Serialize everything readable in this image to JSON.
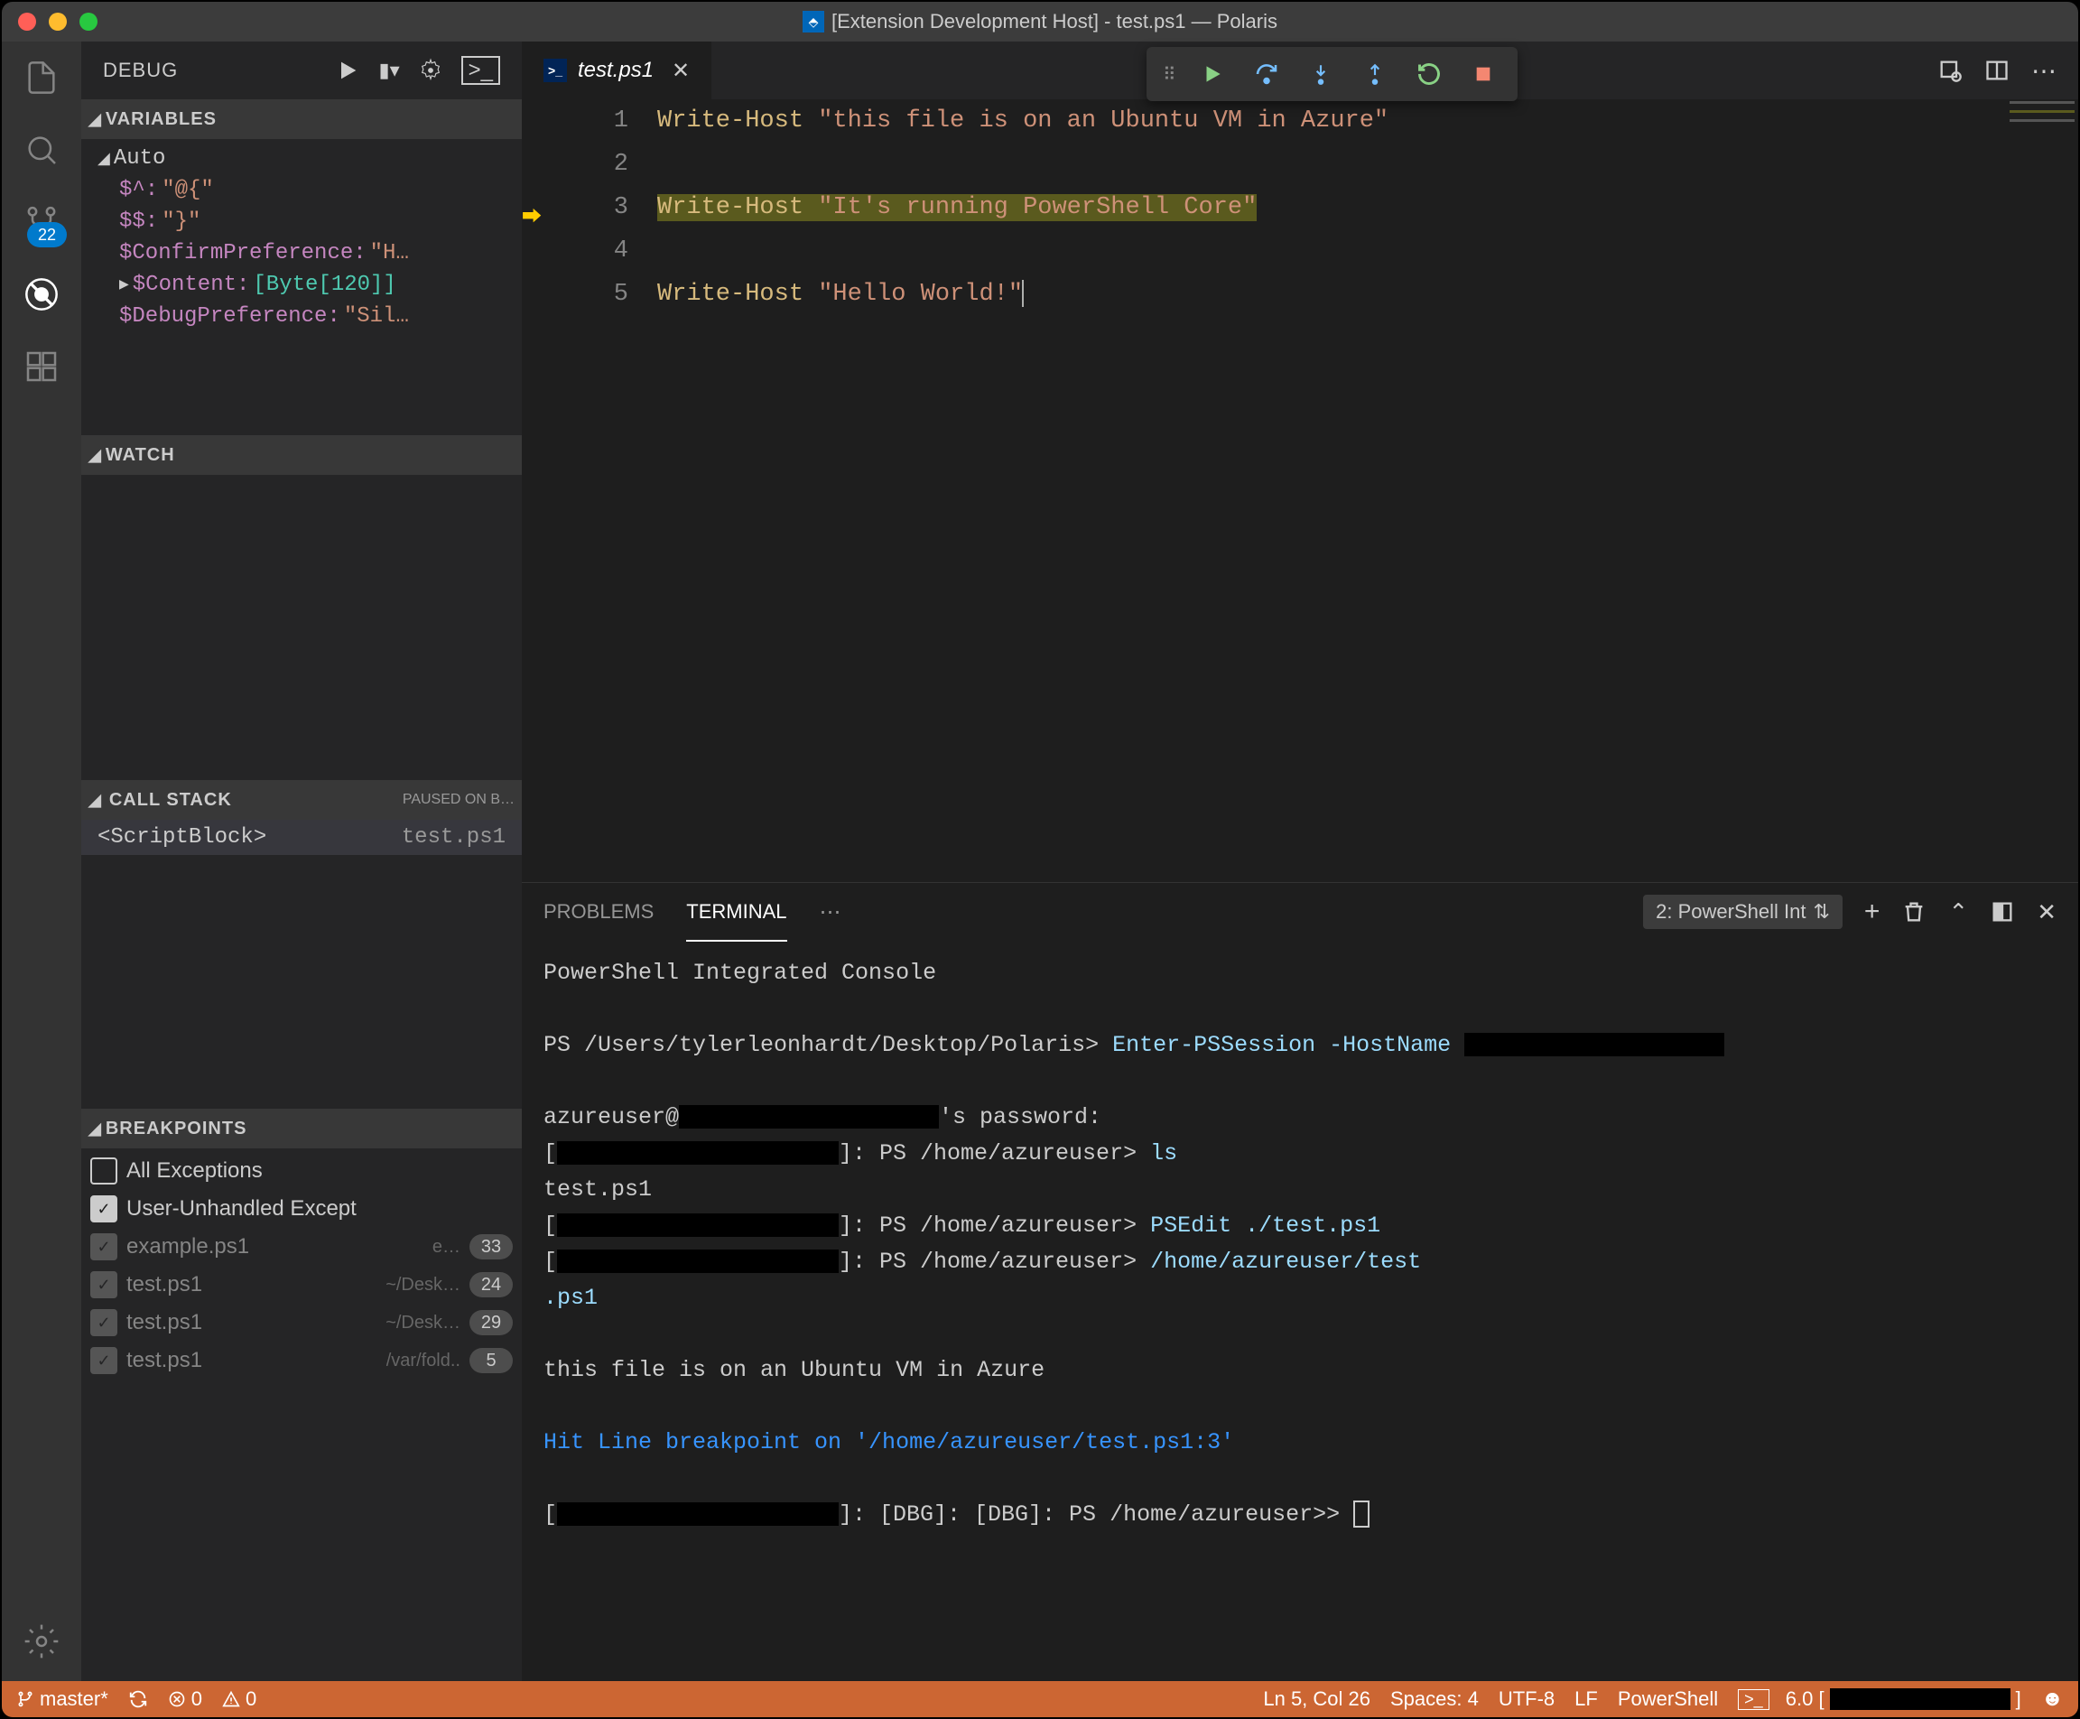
{
  "window": {
    "title": "[Extension Development Host] - test.ps1 — Polaris"
  },
  "activitybar": {
    "scm_badge": "22"
  },
  "sidebar": {
    "title": "DEBUG",
    "variables": {
      "header": "VARIABLES",
      "scope": "Auto",
      "rows": [
        {
          "n": "$^:",
          "v": "\"@{\""
        },
        {
          "n": "$$:",
          "v": "\"}\""
        },
        {
          "n": "$ConfirmPreference:",
          "v": "\"H…"
        },
        {
          "n": "$Content:",
          "t": "[Byte[120]]",
          "exp": true
        },
        {
          "n": "$DebugPreference:",
          "v": "\"Sil…"
        }
      ]
    },
    "watch": {
      "header": "WATCH"
    },
    "callstack": {
      "header": "CALL STACK",
      "state": "PAUSED ON B…",
      "frame": {
        "name": "<ScriptBlock>",
        "file": "test.ps1"
      }
    },
    "breakpoints": {
      "header": "BREAKPOINTS",
      "rows": [
        {
          "label": "All Exceptions",
          "checked": false,
          "dim": false
        },
        {
          "label": "User-Unhandled Except",
          "checked": true,
          "dim": false
        },
        {
          "label": "example.ps1",
          "path": "e…",
          "line": "33",
          "checked": true,
          "dim": true
        },
        {
          "label": "test.ps1",
          "path": "~/Desk…",
          "line": "24",
          "checked": true,
          "dim": true
        },
        {
          "label": "test.ps1",
          "path": "~/Desk…",
          "line": "29",
          "checked": true,
          "dim": true
        },
        {
          "label": "test.ps1",
          "path": "/var/fold..",
          "line": "5",
          "checked": true,
          "dim": true
        }
      ]
    }
  },
  "tabs": {
    "file": "test.ps1"
  },
  "editor": {
    "lines": [
      {
        "n": "1",
        "t": [
          {
            "c": "kw",
            "s": "Write-Host"
          },
          {
            "c": "",
            "s": " "
          },
          {
            "c": "str",
            "s": "\"this file is on an Ubuntu VM in Azure\""
          }
        ]
      },
      {
        "n": "2",
        "t": []
      },
      {
        "n": "3",
        "t": [
          {
            "c": "kw",
            "s": "Write-Host"
          },
          {
            "c": "",
            "s": " "
          },
          {
            "c": "str",
            "s": "\"It's running PowerShell Core\""
          }
        ],
        "hl": true,
        "exec": true
      },
      {
        "n": "4",
        "t": []
      },
      {
        "n": "5",
        "t": [
          {
            "c": "kw",
            "s": "Write-Host"
          },
          {
            "c": "",
            "s": " "
          },
          {
            "c": "str",
            "s": "\"Hello World!\""
          }
        ],
        "cursor": true
      }
    ]
  },
  "panel": {
    "tabs": {
      "problems": "PROBLEMS",
      "terminal": "TERMINAL"
    },
    "term_select": "2: PowerShell Int",
    "terminal_lines": [
      {
        "segs": [
          {
            "s": "PowerShell Integrated Console"
          }
        ]
      },
      {
        "segs": []
      },
      {
        "segs": [
          {
            "s": "PS /Users/tylerleonhardt/Desktop/Polaris> "
          },
          {
            "c": "tprompt",
            "s": "Enter-PSSession -HostName "
          },
          {
            "r": 24
          }
        ]
      },
      {
        "segs": []
      },
      {
        "segs": [
          {
            "s": "azureuser@"
          },
          {
            "r": 24
          },
          {
            "s": "'s password:"
          }
        ]
      },
      {
        "segs": [
          {
            "s": "["
          },
          {
            "r": 26
          },
          {
            "s": "]: PS /home/azureuser> "
          },
          {
            "c": "tprompt",
            "s": "ls"
          }
        ]
      },
      {
        "segs": [
          {
            "s": "test.ps1"
          }
        ]
      },
      {
        "segs": [
          {
            "s": "["
          },
          {
            "r": 26
          },
          {
            "s": "]: PS /home/azureuser> "
          },
          {
            "c": "tprompt",
            "s": "PSEdit ./test.ps1"
          }
        ]
      },
      {
        "segs": [
          {
            "s": "["
          },
          {
            "r": 26
          },
          {
            "s": "]: PS /home/azureuser> "
          },
          {
            "c": "tprompt",
            "s": "/home/azureuser/test"
          }
        ]
      },
      {
        "segs": [
          {
            "c": "tprompt",
            "s": ".ps1"
          }
        ]
      },
      {
        "segs": []
      },
      {
        "segs": [
          {
            "s": "this file is on an Ubuntu VM in Azure"
          }
        ]
      },
      {
        "segs": []
      },
      {
        "segs": [
          {
            "c": "tblue",
            "s": "Hit Line breakpoint on '/home/azureuser/test.ps1:3'"
          }
        ]
      },
      {
        "segs": []
      },
      {
        "segs": [
          {
            "s": "["
          },
          {
            "r": 26
          },
          {
            "s": "]: [DBG]: [DBG]: PS /home/azureuser>> "
          },
          {
            "cur": true
          }
        ]
      }
    ]
  },
  "statusbar": {
    "branch": "master*",
    "errors": "0",
    "warnings": "0",
    "pos": "Ln 5, Col 26",
    "spaces": "Spaces: 4",
    "encoding": "UTF-8",
    "eol": "LF",
    "lang": "PowerShell",
    "term": "6.0 ["
  }
}
